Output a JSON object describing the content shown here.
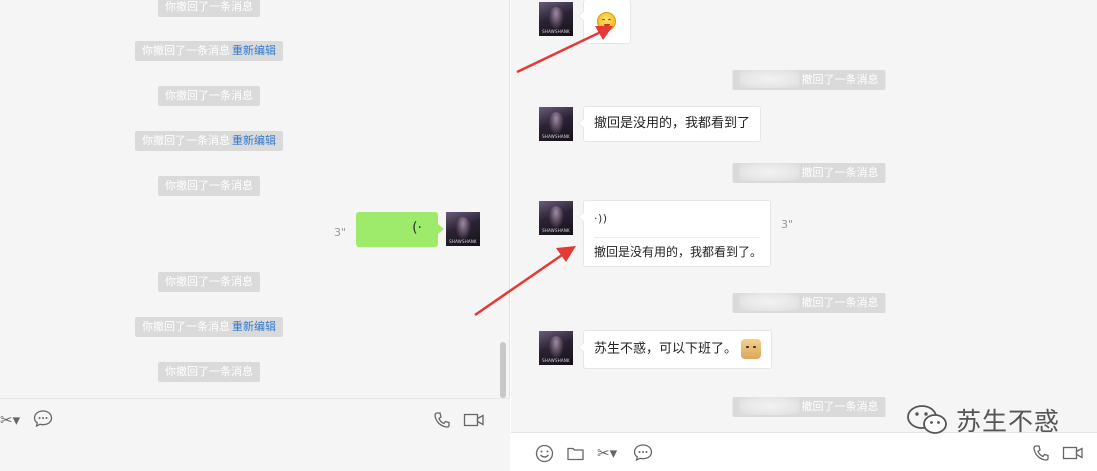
{
  "left_pane": {
    "notices": [
      {
        "text": "你撤回了一条消息",
        "link": ""
      },
      {
        "text": "你撤回了一条消息",
        "link": "重新编辑"
      },
      {
        "text": "你撤回了一条消息",
        "link": ""
      },
      {
        "text": "你撤回了一条消息",
        "link": "重新编辑"
      },
      {
        "text": "你撤回了一条消息",
        "link": ""
      },
      {
        "text": "你撤回了一条消息",
        "link": ""
      },
      {
        "text": "你撤回了一条消息",
        "link": "重新编辑"
      },
      {
        "text": "你撤回了一条消息",
        "link": ""
      }
    ],
    "voice_message": {
      "duration": "3\""
    },
    "avatar_caption": "SHAWSHANK"
  },
  "right_pane": {
    "messages": [
      {
        "text": "撤回是没用的，我都看到了"
      },
      {
        "transcript": "撤回是没有用的，我都看到了。",
        "duration": "3\""
      },
      {
        "text": "苏生不惑，可以下班了。"
      }
    ],
    "recall_notice": "撤回了一条消息",
    "avatar_caption": "SHAWSHANK"
  },
  "watermark": {
    "text": "苏生不惑"
  },
  "icons": {
    "scissors": "scissors-icon",
    "chat": "chat-bubble-icon",
    "phone": "phone-icon",
    "video": "video-icon",
    "emoji": "emoji-icon",
    "folder": "folder-icon"
  },
  "colors": {
    "voice_bubble": "#9eea6a",
    "link": "#2e7ad1",
    "notice_bg": "#dadada",
    "arrow": "#e53935"
  }
}
